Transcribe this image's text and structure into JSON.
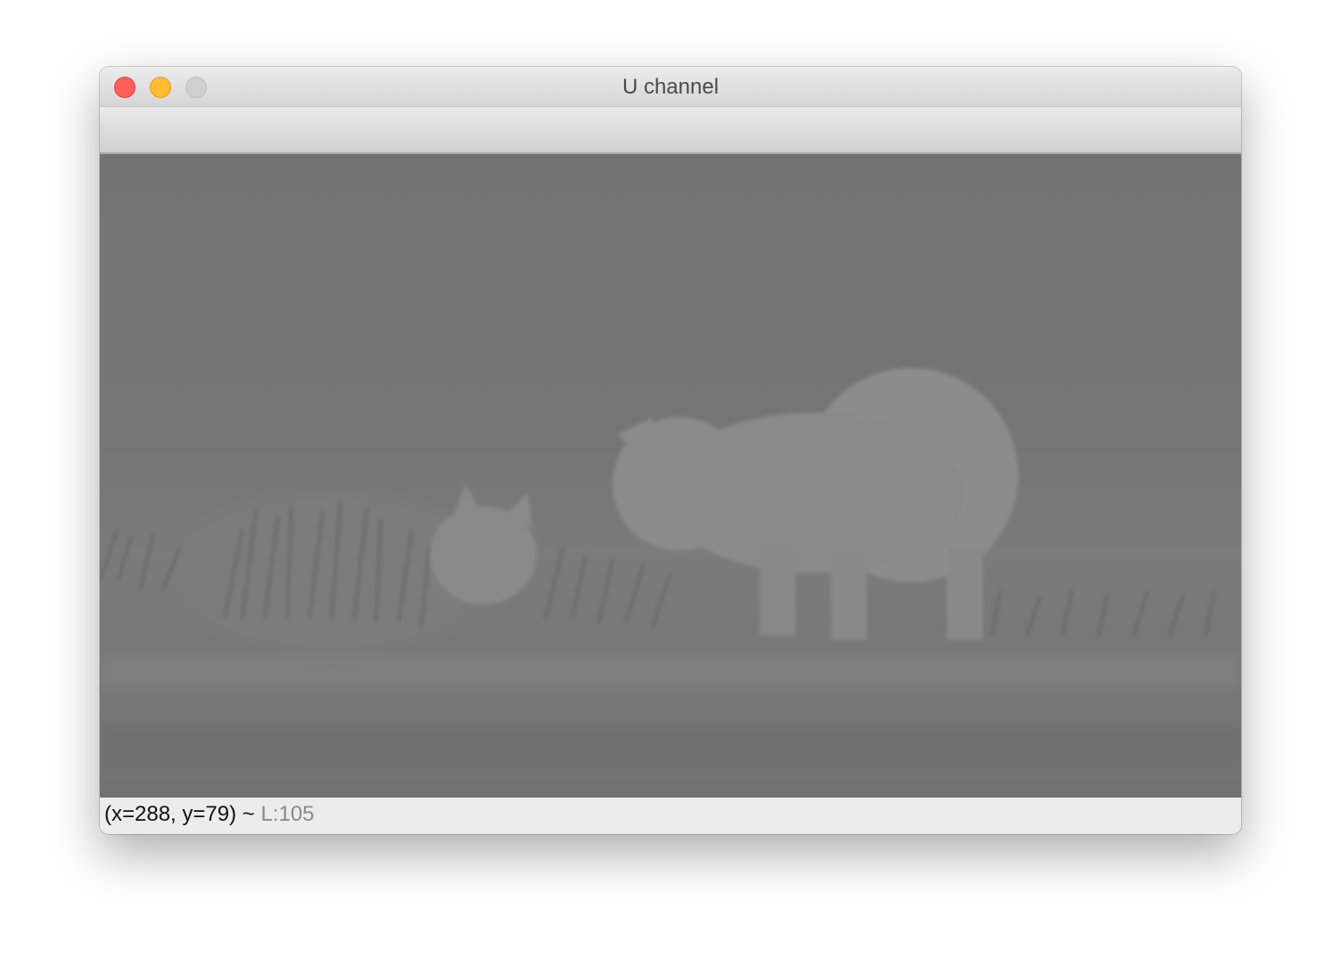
{
  "window": {
    "title": "U channel"
  },
  "image": {
    "description_icon": "grayscale-cats-image"
  },
  "status": {
    "coords": "(x=288, y=79) ~ ",
    "value": "L:105"
  },
  "colors": {
    "close": "#fe5f57",
    "minimize": "#febc2e",
    "zoom": "#cfcfcf",
    "image_background": "#747474"
  }
}
